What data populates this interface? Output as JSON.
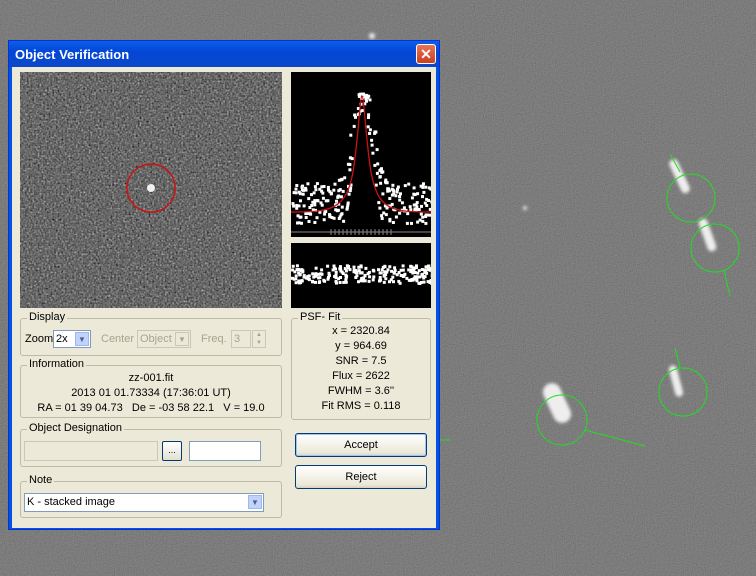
{
  "window": {
    "title": "Object Verification"
  },
  "display": {
    "group_label": "Display",
    "zoom_label": "Zoom",
    "zoom_value": "2x",
    "center_label": "Center",
    "center_value": "Object",
    "freq_label": "Freq.",
    "freq_value": "3"
  },
  "information": {
    "group_label": "Information",
    "filename": "zz-001.fit",
    "datetime": "2013 01 01.73334 (17:36:01 UT)",
    "coords": "RA = 01 39 04.73   De = -03 58 22.1   V = 19.0"
  },
  "designation": {
    "group_label": "Object Designation",
    "browse_label": "..."
  },
  "note": {
    "group_label": "Note",
    "value": "K - stacked image"
  },
  "psf": {
    "group_label": "PSF- Fit",
    "x": "x = 2320.84",
    "y": "y = 964.69",
    "snr": "SNR = 7.5",
    "flux": "Flux = 2622",
    "fwhm": "FWHM = 3.6''",
    "rms": "Fit RMS = 0.118"
  },
  "buttons": {
    "accept": "Accept",
    "reject": "Reject"
  },
  "colors": {
    "titlebar": "#0347d6",
    "marker_green": "#22dd22",
    "marker_red": "#cc1111",
    "fit_curve": "#cc1111"
  }
}
